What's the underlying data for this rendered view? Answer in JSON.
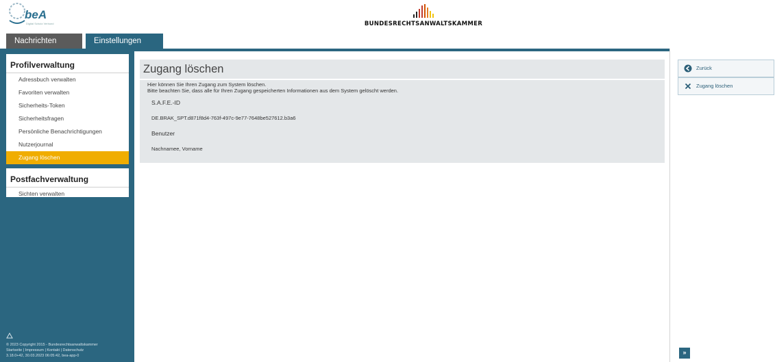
{
  "header": {
    "logo_text": "beA",
    "logo_subtitle": "Digital Schutz Verbund",
    "org_name": "BUNDESRECHTSANWALTSKAMMER"
  },
  "tabs": [
    {
      "label": "Nachrichten"
    },
    {
      "label": "Einstellungen"
    }
  ],
  "sidebar": {
    "profile_heading": "Profilverwaltung",
    "profile_items": [
      {
        "label": "Adressbuch verwalten"
      },
      {
        "label": "Favoriten verwalten"
      },
      {
        "label": "Sicherheits-Token"
      },
      {
        "label": "Sicherheitsfragen"
      },
      {
        "label": "Persönliche Benachrichtigungen"
      },
      {
        "label": "Nutzerjournal"
      },
      {
        "label": "Zugang löschen"
      }
    ],
    "postfach_heading": "Postfachverwaltung",
    "postfach_items": [
      {
        "label": "Sichten verwalten"
      }
    ],
    "footer": {
      "copyright": "© 2023 Copyright 2015 - Bundesrechtsanwaltskammer",
      "links": "Startseite | Impressum | Kontakt | Datenschutz",
      "version": "3.18.0+42, 30.03.2023 06:05:42, bea-app-0"
    }
  },
  "main": {
    "title": "Zugang löschen",
    "desc_line1": "Hier können Sie Ihren Zugang zum System löschen.",
    "desc_line2": "Bitte beachten Sie, dass alle für Ihren Zugang gespeicherten Informationen aus dem System gelöscht werden.",
    "safe_label": "S.A.F.E.-ID",
    "safe_value": "DE.BRAK_SPT.d871f8d4-763f-497c-9e77-7648be527612.b3a6",
    "user_label": "Benutzer",
    "user_value": "Nachnamee, Vorname"
  },
  "actions": {
    "back_label": "Zurück",
    "delete_label": "Zugang löschen",
    "expand_label": "»"
  },
  "colors": {
    "brand_blue": "#2b6680",
    "active_yellow": "#f0ad00",
    "tab_grey": "#5b5b5b"
  }
}
